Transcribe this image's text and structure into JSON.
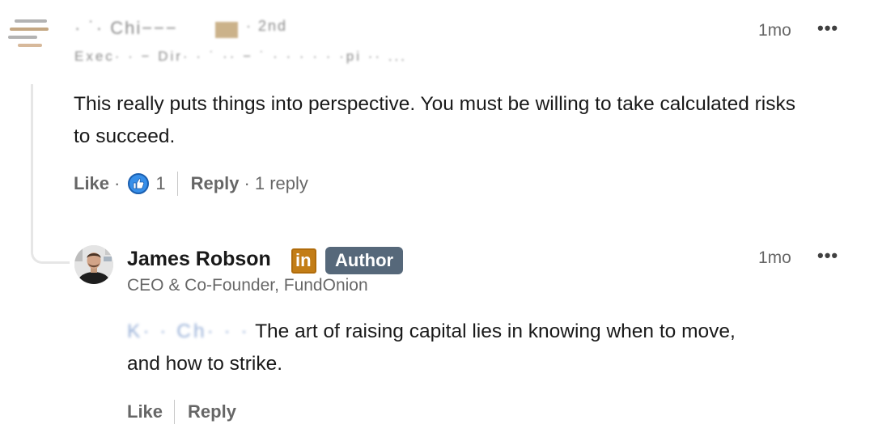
{
  "colors": {
    "accent_like": "#378fe9",
    "linkedin_badge": "#c37d16",
    "author_pill": "#56687a",
    "thread_line": "#e6e6e6"
  },
  "parent_comment": {
    "author_name": "· ˙· Chi−−−",
    "author_suffix": "· 2nd",
    "headline_blurred": "Exec· · − Dir· · ˙ ·· − ˙ · · · · · ·pi ·· ...",
    "time": "1mo",
    "more_icon": "ellipsis-icon",
    "body": "This really puts things into perspective. You must be willing to take calculated risks to succeed.",
    "actions": {
      "like_label": "Like",
      "separator": "·",
      "reaction_icon": "thumbs-up-icon",
      "reaction_count": "1",
      "reply_label": "Reply",
      "reply_count": "1 reply"
    }
  },
  "reply_comment": {
    "author_name": "James Robson",
    "badge_icon": "linkedin-icon",
    "badge_text": "in",
    "author_pill": "Author",
    "headline": "CEO & Co-Founder, FundOnion",
    "time": "1mo",
    "more_icon": "ellipsis-icon",
    "mention_blurred": "K· · Ch· · ·",
    "body_line1": "The art of raising capital lies in knowing when to move,",
    "body_line2": "and how to strike.",
    "actions": {
      "like_label": "Like",
      "reply_label": "Reply"
    }
  }
}
